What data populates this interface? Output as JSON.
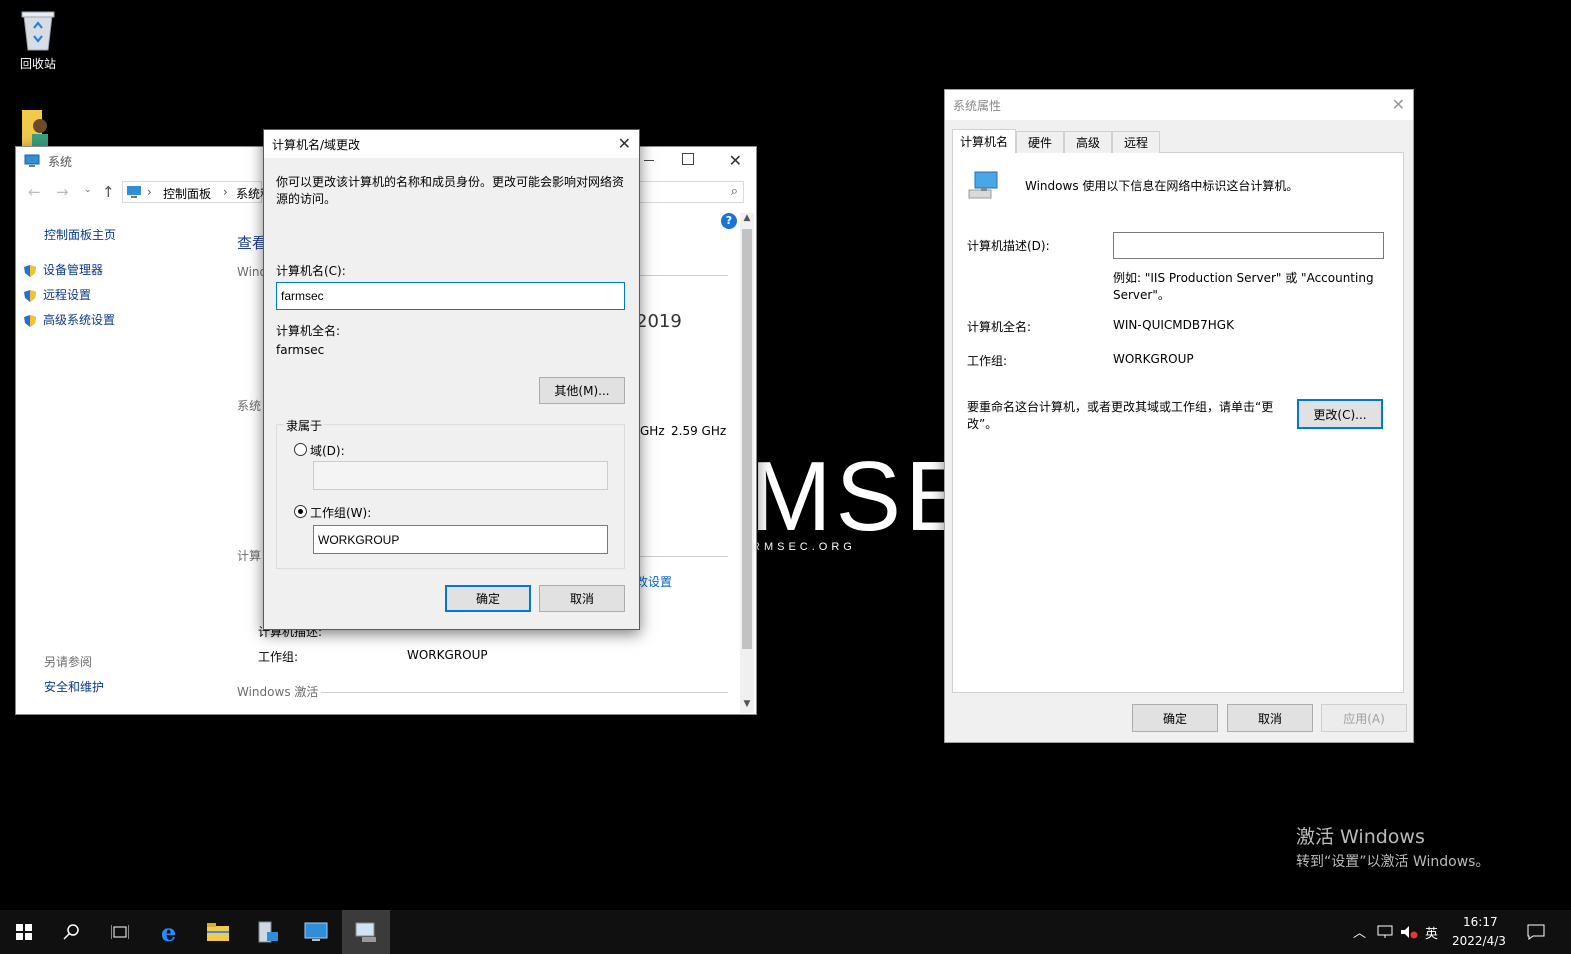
{
  "desktop": {
    "recycle_bin_label": "回收站",
    "wallpaper": {
      "big_text": "MSE",
      "site": "RMSEC.ORG"
    },
    "activation": {
      "title": "激活 Windows",
      "subtitle": "转到“设置”以激活 Windows。"
    }
  },
  "system_window": {
    "title": "系统",
    "breadcrumb": [
      "控制面板",
      "系统和"
    ],
    "sidebar": {
      "home_link": "控制面板主页",
      "links": [
        "设备管理器",
        "远程设置",
        "高级系统设置"
      ],
      "see_also_header": "另请参阅",
      "see_also_links": [
        "安全和维护"
      ]
    },
    "main": {
      "heading_fragment": "查看",
      "windows_edition_fragment": "Wind",
      "year_fragment": "2019",
      "system_section_fragment": "系统",
      "cpu_speed_fragment": "GHz",
      "cpu_speed": "2.59 GHz",
      "computer_section_fragment": "计算",
      "change_settings_fragment": "改设置",
      "computer_description_label": "计算机描述:",
      "workgroup_label": "工作组:",
      "workgroup_value": "WORKGROUP",
      "activation_header": "Windows 激活"
    }
  },
  "rename_dialog": {
    "title": "计算机名/域更改",
    "description": "你可以更改该计算机的名称和成员身份。更改可能会影响对网络资源的访问。",
    "computer_name_label": "计算机名(C):",
    "computer_name_value": "farmsec",
    "full_name_label": "计算机全名:",
    "full_name_value": "farmsec",
    "more_button": "其他(M)...",
    "member_of_label": "隶属于",
    "domain_radio_label": "域(D):",
    "domain_value": "",
    "workgroup_radio_label": "工作组(W):",
    "workgroup_value": "WORKGROUP",
    "ok_button": "确定",
    "cancel_button": "取消"
  },
  "sysprops_dialog": {
    "title": "系统属性",
    "tabs": [
      "计算机名",
      "硬件",
      "高级",
      "远程"
    ],
    "intro_text": "Windows 使用以下信息在网络中标识这台计算机。",
    "description_label": "计算机描述(D):",
    "description_value": "",
    "example_text": "例如: \"IIS Production Server\" 或 \"Accounting Server\"。",
    "full_name_label": "计算机全名:",
    "full_name_value": "WIN-QUICMDB7HGK",
    "workgroup_label": "工作组:",
    "workgroup_value": "WORKGROUP",
    "rename_text": "要重命名这台计算机，或者更改其域或工作组，请单击“更改”。",
    "change_button": "更改(C)...",
    "ok_button": "确定",
    "cancel_button": "取消",
    "apply_button": "应用(A)"
  },
  "taskbar": {
    "ime": "英",
    "time": "16:17",
    "date": "2022/4/3"
  },
  "colors": {
    "accent": "#0078d7",
    "link": "#0b3a8c",
    "taskbar": "#101010"
  }
}
